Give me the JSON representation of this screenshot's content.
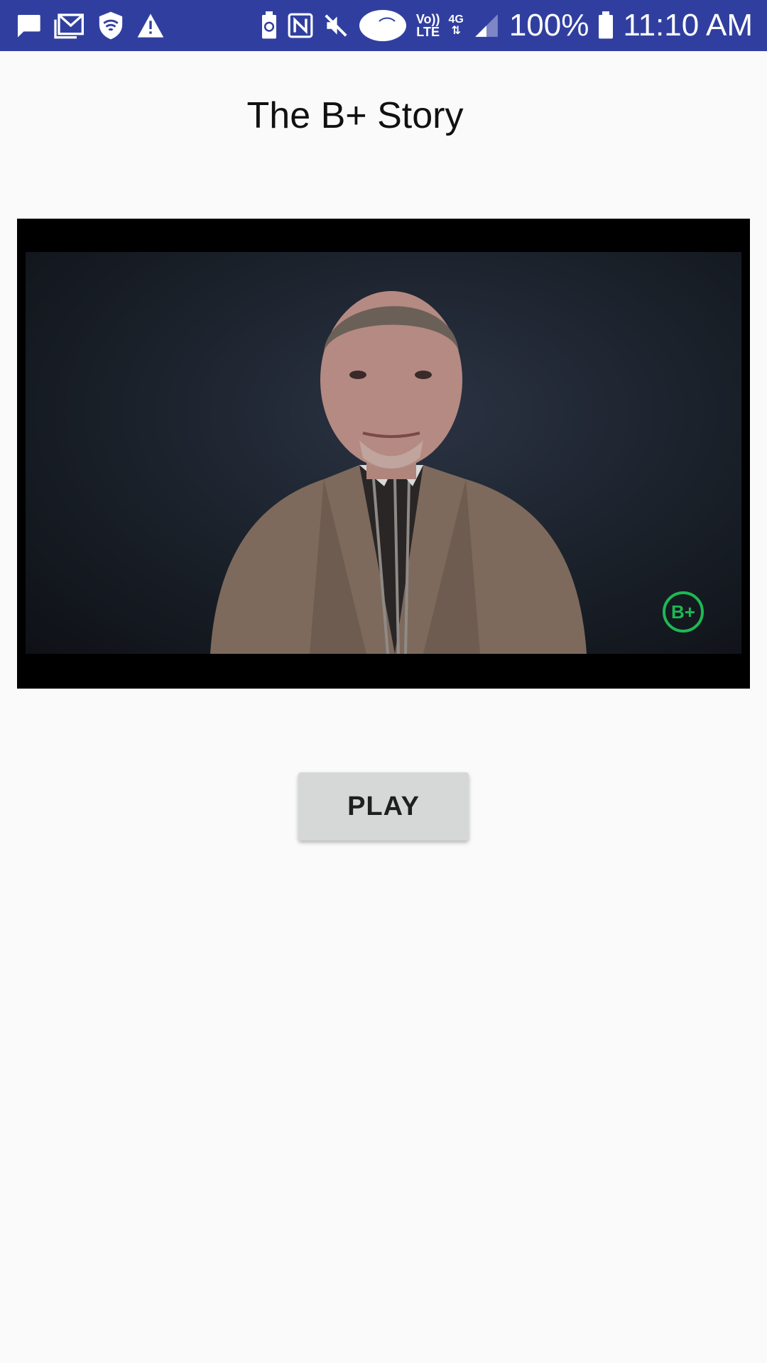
{
  "status_bar": {
    "left_icons": [
      "message-icon",
      "email-icon",
      "shield-wifi-icon",
      "warning-icon"
    ],
    "right_icons": [
      "battery-saver-icon",
      "nfc-icon",
      "mute-icon",
      "cloud-icon",
      "volte-icon",
      "4g-lte-icon",
      "signal-icon",
      "battery-icon"
    ],
    "volte_top": "Vo))",
    "volte_bottom": "LTE",
    "network_label": "4G",
    "battery_percent": "100%",
    "time": "11:10 AM",
    "background_color": "#303f9f"
  },
  "page": {
    "title": "The B+ Story"
  },
  "video": {
    "brand_logo_text": "B+",
    "logo_color": "#1db954"
  },
  "controls": {
    "play_label": "PLAY"
  }
}
